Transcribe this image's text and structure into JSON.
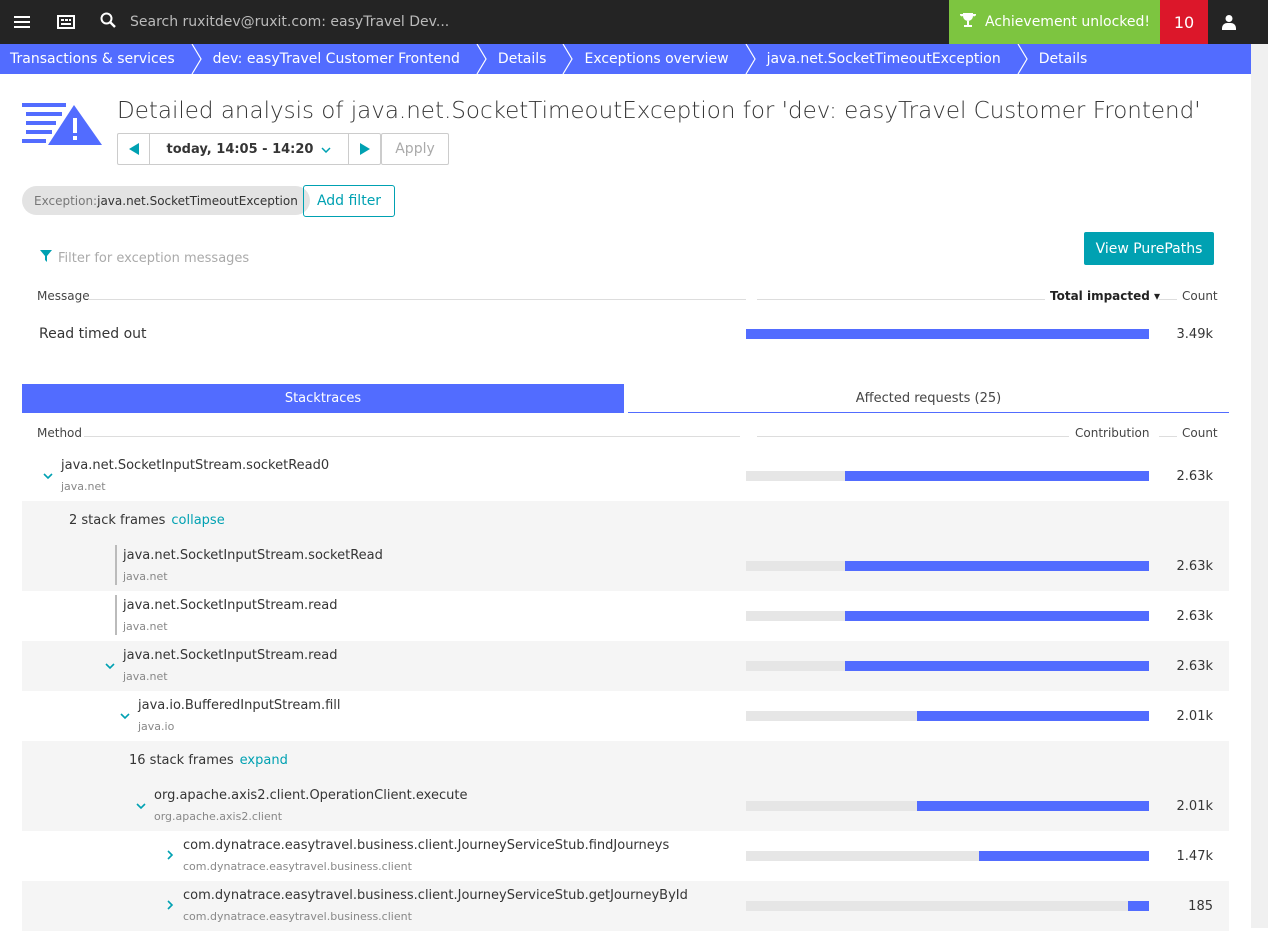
{
  "topbar": {
    "search_placeholder": "Search ruxitdev@ruxit.com: easyTravel Dev...",
    "achievement_label": "Achievement unlocked!",
    "achievement_count": "10"
  },
  "breadcrumb": [
    "Transactions & services",
    "dev: easyTravel Customer Frontend",
    "Details",
    "Exceptions overview",
    "java.net.SocketTimeoutException",
    "Details"
  ],
  "page": {
    "title": "Detailed analysis of java.net.SocketTimeoutException for 'dev: easyTravel Customer Frontend'",
    "timeframe": "today, 14:05 - 14:20",
    "apply_label": "Apply",
    "chip_key": "Exception: ",
    "chip_value": "java.net.SocketTimeoutException",
    "add_filter_label": "Add filter",
    "filter_placeholder": "Filter for exception messages",
    "view_purepaths_label": "View PurePaths"
  },
  "messages_table": {
    "col_message": "Message",
    "col_total": "Total impacted ▾",
    "col_count": "Count",
    "rows": [
      {
        "message": "Read timed out",
        "count": "3.49k",
        "fraction": 1.0
      }
    ]
  },
  "tabs": {
    "stacktraces": "Stacktraces",
    "affected": "Affected requests (25)"
  },
  "stack_table": {
    "col_method": "Method",
    "col_contribution": "Contribution",
    "col_count": "Count",
    "rows": [
      {
        "method": "java.net.SocketInputStream.socketRead0",
        "package": "java.net",
        "count": "2.63k",
        "fraction": 0.754
      },
      {
        "frames": "2 stack frames",
        "link": "collapse"
      },
      {
        "method": "java.net.SocketInputStream.socketRead",
        "package": "java.net",
        "count": "2.63k",
        "fraction": 0.754
      },
      {
        "method": "java.net.SocketInputStream.read",
        "package": "java.net",
        "count": "2.63k",
        "fraction": 0.754
      },
      {
        "method": "java.net.SocketInputStream.read",
        "package": "java.net",
        "count": "2.63k",
        "fraction": 0.754
      },
      {
        "method": "java.io.BufferedInputStream.fill",
        "package": "java.io",
        "count": "2.01k",
        "fraction": 0.576
      },
      {
        "frames": "16 stack frames",
        "link": "expand"
      },
      {
        "method": "org.apache.axis2.client.OperationClient.execute",
        "package": "org.apache.axis2.client",
        "count": "2.01k",
        "fraction": 0.576
      },
      {
        "method": "com.dynatrace.easytravel.business.client.JourneyServiceStub.findJourneys",
        "package": "com.dynatrace.easytravel.business.client",
        "count": "1.47k",
        "fraction": 0.421
      },
      {
        "method": "com.dynatrace.easytravel.business.client.JourneyServiceStub.getJourneyById",
        "package": "com.dynatrace.easytravel.business.client",
        "count": "185",
        "fraction": 0.053
      }
    ]
  }
}
